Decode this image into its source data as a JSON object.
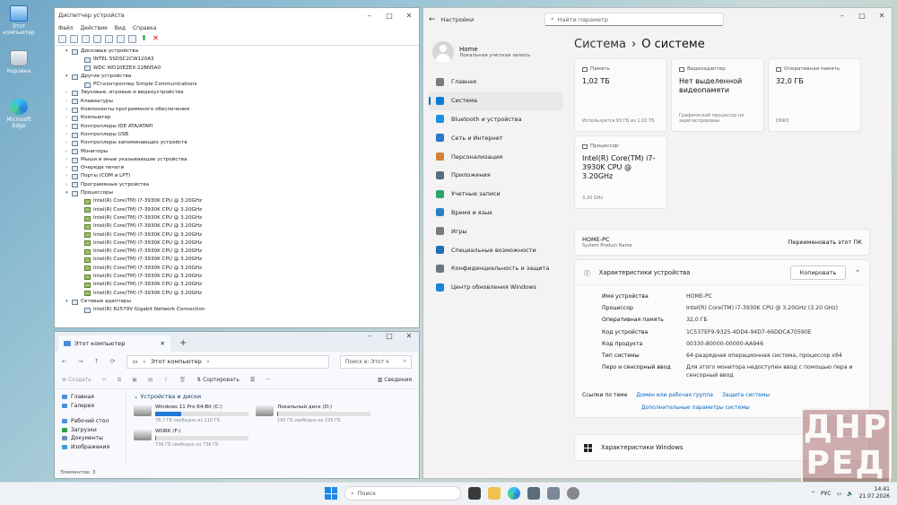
{
  "desktop": {
    "icons": [
      {
        "label": "Этот компьютер",
        "icon": "pc-icon"
      },
      {
        "label": "Корзина",
        "icon": "recycle-bin-icon"
      },
      {
        "label": "Microsoft Edge",
        "icon": "edge-icon"
      }
    ]
  },
  "devmgr": {
    "title": "Диспетчер устройств",
    "menu": [
      "Файл",
      "Действие",
      "Вид",
      "Справка"
    ],
    "tree": [
      {
        "level": 0,
        "arrow": "▾",
        "label": "Дисковые устройства"
      },
      {
        "level": 1,
        "label": "INTEL SSDSC2CW120A3"
      },
      {
        "level": 1,
        "label": "WDC WD10EZEX-22BN5A0"
      },
      {
        "level": 0,
        "arrow": "▾",
        "label": "Другие устройства"
      },
      {
        "level": 1,
        "label": "PCI-контроллер Simple Communications"
      },
      {
        "level": 0,
        "arrow": "›",
        "label": "Звуковые, игровые и видеоустройства"
      },
      {
        "level": 0,
        "arrow": "›",
        "label": "Клавиатуры"
      },
      {
        "level": 0,
        "arrow": "›",
        "label": "Компоненты программного обеспечения"
      },
      {
        "level": 0,
        "arrow": "›",
        "label": "Компьютер"
      },
      {
        "level": 0,
        "arrow": "›",
        "label": "Контроллеры IDE ATA/ATAPI"
      },
      {
        "level": 0,
        "arrow": "›",
        "label": "Контроллеры USB"
      },
      {
        "level": 0,
        "arrow": "›",
        "label": "Контроллеры запоминающих устройств"
      },
      {
        "level": 0,
        "arrow": "›",
        "label": "Мониторы"
      },
      {
        "level": 0,
        "arrow": "›",
        "label": "Мыши и иные указывающие устройства"
      },
      {
        "level": 0,
        "arrow": "›",
        "label": "Очереди печати"
      },
      {
        "level": 0,
        "arrow": "›",
        "label": "Порты (COM и LPT)"
      },
      {
        "level": 0,
        "arrow": "›",
        "label": "Программные устройства"
      },
      {
        "level": 0,
        "arrow": "▾",
        "label": "Процессоры"
      },
      {
        "level": 1,
        "cpu": true,
        "label": "Intel(R) Core(TM) i7-3930K CPU @ 3.20GHz"
      },
      {
        "level": 1,
        "cpu": true,
        "label": "Intel(R) Core(TM) i7-3930K CPU @ 3.20GHz"
      },
      {
        "level": 1,
        "cpu": true,
        "label": "Intel(R) Core(TM) i7-3930K CPU @ 3.20GHz"
      },
      {
        "level": 1,
        "cpu": true,
        "label": "Intel(R) Core(TM) i7-3930K CPU @ 3.20GHz"
      },
      {
        "level": 1,
        "cpu": true,
        "label": "Intel(R) Core(TM) i7-3930K CPU @ 3.20GHz"
      },
      {
        "level": 1,
        "cpu": true,
        "label": "Intel(R) Core(TM) i7-3930K CPU @ 3.20GHz"
      },
      {
        "level": 1,
        "cpu": true,
        "label": "Intel(R) Core(TM) i7-3930K CPU @ 3.20GHz"
      },
      {
        "level": 1,
        "cpu": true,
        "label": "Intel(R) Core(TM) i7-3930K CPU @ 3.20GHz"
      },
      {
        "level": 1,
        "cpu": true,
        "label": "Intel(R) Core(TM) i7-3930K CPU @ 3.20GHz"
      },
      {
        "level": 1,
        "cpu": true,
        "label": "Intel(R) Core(TM) i7-3930K CPU @ 3.20GHz"
      },
      {
        "level": 1,
        "cpu": true,
        "label": "Intel(R) Core(TM) i7-3930K CPU @ 3.20GHz"
      },
      {
        "level": 1,
        "cpu": true,
        "label": "Intel(R) Core(TM) i7-3930K CPU @ 3.20GHz"
      },
      {
        "level": 0,
        "arrow": "▾",
        "label": "Сетевые адаптеры"
      },
      {
        "level": 1,
        "label": "Intel(R) 82579V Gigabit Network Connection"
      }
    ]
  },
  "explorer": {
    "tab_title": "Этот компьютер",
    "path": "Этот компьютер",
    "search_placeholder": "Поиск в: Этот к",
    "cmd": {
      "create": "Создать",
      "sort": "Сортировать",
      "details": "Сведения"
    },
    "side": [
      "Главная",
      "Галерея",
      "Рабочий стол",
      "Загрузки",
      "Документы",
      "Изображения"
    ],
    "group": "Устройства и диски",
    "drives": [
      {
        "name": "Windows 11 Pro 64-Bit (C:)",
        "free": "78,7 ГБ свободно из 110 ГБ",
        "fill": 0.28
      },
      {
        "name": "Локальный диск (D:)",
        "free": "195 ГБ свободно из 195 ГБ",
        "fill": 0.01
      },
      {
        "name": "WORK (F:)",
        "free": "736 ГБ свободно из 736 ГБ",
        "fill": 0.01
      }
    ],
    "status": "Элементов: 3"
  },
  "settings": {
    "app_title": "Настройки",
    "search_placeholder": "Найти параметр",
    "profile": {
      "name": "Home",
      "sub": "Локальная учетная запись"
    },
    "nav": [
      {
        "label": "Главная",
        "color": "#7a7a7a"
      },
      {
        "label": "Система",
        "color": "#0a7ad6",
        "active": true
      },
      {
        "label": "Bluetooth и устройства",
        "color": "#1e8fe0"
      },
      {
        "label": "Сеть и Интернет",
        "color": "#2b78c8"
      },
      {
        "label": "Персонализация",
        "color": "#d4813b"
      },
      {
        "label": "Приложения",
        "color": "#5a6c7d"
      },
      {
        "label": "Учетные записи",
        "color": "#2fa56a"
      },
      {
        "label": "Время и язык",
        "color": "#2d7fc9"
      },
      {
        "label": "Игры",
        "color": "#7a7a7a"
      },
      {
        "label": "Специальные возможности",
        "color": "#1f6fb5"
      },
      {
        "label": "Конфиденциальность и защита",
        "color": "#6b7580"
      },
      {
        "label": "Центр обновления Windows",
        "color": "#1d86d6"
      }
    ],
    "crumb": {
      "parent": "Система",
      "sep": "›",
      "current": "О системе"
    },
    "cards": [
      {
        "title": "Память",
        "value": "1,02 ТБ",
        "foot": "Используется 93 ГБ из 1,02 ТБ"
      },
      {
        "title": "Видеоадаптер",
        "value": "Нет выделенной видеопамяти",
        "foot": "Графический процессор не зарегистрирован"
      },
      {
        "title": "Оперативная память",
        "value": "32,0 ГБ",
        "foot": "DDR3"
      },
      {
        "title": "Процессор",
        "value": "Intel(R) Core(TM) i7-3930K CPU @ 3.20GHz",
        "foot": "3,20 GHz"
      }
    ],
    "device": {
      "name": "HOME-PC",
      "sub": "System Product Name",
      "rename": "Переименовать этот ПК"
    },
    "specs": {
      "title": "Характеристики устройства",
      "copy": "Копировать",
      "rows": [
        {
          "k": "Имя устройства",
          "v": "HOME-PC"
        },
        {
          "k": "Процессор",
          "v": "Intel(R) Core(TM) i7-3930K CPU @ 3.20GHz (3.20 GHz)"
        },
        {
          "k": "Оперативная память",
          "v": "32,0 ГБ"
        },
        {
          "k": "Код устройства",
          "v": "1C537EF9-9325-4DD4-94D7-66DDCA70590E"
        },
        {
          "k": "Код продукта",
          "v": "00330-80000-00000-AA946"
        },
        {
          "k": "Тип системы",
          "v": "64-разрядная операционная система, процессор x64"
        },
        {
          "k": "Перо и сенсорный ввод",
          "v": "Для этого монитора недоступен ввод с помощью пера и сенсорный ввод"
        }
      ]
    },
    "links": {
      "label": "Ссылки по теме",
      "items": [
        "Домен или рабочая группа",
        "Защита системы"
      ],
      "advanced": "Дополнительные параметры системы"
    },
    "windows_spec": "Характеристики Windows"
  },
  "watermark": {
    "line1": "ДНР",
    "line2": "РЕД"
  },
  "taskbar": {
    "search": "Поиск",
    "lang": "РУС",
    "time": "14:41",
    "date": "21.07.2026",
    "apps": [
      "file-explorer-icon",
      "edge-icon",
      "settings-icon",
      "device-manager-icon",
      "store-icon"
    ]
  },
  "colors": {
    "accent": "#0067c0"
  }
}
